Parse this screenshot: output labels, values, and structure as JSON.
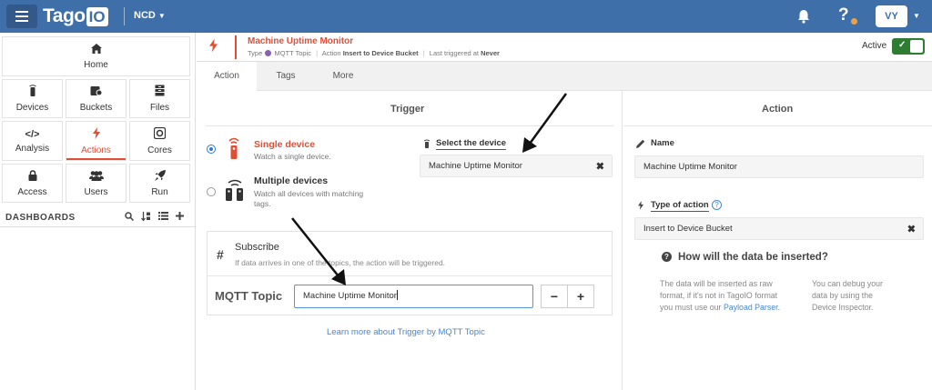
{
  "topbar": {
    "logo_tago": "Tago",
    "logo_io": "IO",
    "profile": "NCD",
    "avatar_initials": "VY",
    "help_glyph": "?"
  },
  "sidebar": {
    "tiles": [
      {
        "label": "Home",
        "icon": "home-icon"
      },
      {
        "label": "Devices",
        "icon": "device-icon"
      },
      {
        "label": "Buckets",
        "icon": "bucket-icon"
      },
      {
        "label": "Files",
        "icon": "file-cabinet-icon"
      },
      {
        "label": "Analysis",
        "icon": "code-icon"
      },
      {
        "label": "Actions",
        "icon": "bolt-icon"
      },
      {
        "label": "Cores",
        "icon": "core-icon"
      },
      {
        "label": "Access",
        "icon": "lock-icon"
      },
      {
        "label": "Users",
        "icon": "users-icon"
      },
      {
        "label": "Run",
        "icon": "rocket-icon"
      }
    ],
    "dashboards_heading": "DASHBOARDS"
  },
  "action_header": {
    "title": "Machine Uptime Monitor",
    "type_label": "Type",
    "type_value": "MQTT Topic",
    "action_label": "Action",
    "action_value": "Insert to Device Bucket",
    "last_triggered_label": "Last triggered at",
    "last_triggered_value": "Never",
    "active_label": "Active",
    "active_toggle": true,
    "accent_color": "#e04e36"
  },
  "tabs": [
    {
      "label": "Action",
      "active": true
    },
    {
      "label": "Tags",
      "active": false
    },
    {
      "label": "More",
      "active": false
    }
  ],
  "trigger": {
    "title": "Trigger",
    "options": [
      {
        "title": "Single device",
        "desc": "Watch a single device.",
        "checked": true
      },
      {
        "title": "Multiple devices",
        "desc_line1": "Watch all devices with matching",
        "desc_line2": "tags.",
        "checked": false
      }
    ],
    "select_device_label": "Select the device",
    "select_device_value": "Machine Uptime Monitor",
    "subscribe": {
      "title": "Subscribe",
      "desc": "If data arrives in one of the topics, the action will be triggered.",
      "mqtt_label": "MQTT Topic",
      "mqtt_value": "Machine Uptime Monitor",
      "minus": "−",
      "plus": "+"
    },
    "learn_more": "Learn more about Trigger by MQTT Topic"
  },
  "action": {
    "title": "Action",
    "name_label": "Name",
    "name_value": "Machine Uptime Monitor",
    "type_label": "Type of action",
    "type_value": "Insert to Device Bucket",
    "how_title": "How will the data be inserted?",
    "how_col1_line1": "The data will be inserted as raw",
    "how_col1_line2": "format, if it's not in TagoIO format",
    "how_col1_line3": "you must use our",
    "how_col1_link": "Payload Parser.",
    "how_col2_line1": "You can debug your",
    "how_col2_line2": "data by using the",
    "how_col2_line3": "Device Inspector."
  }
}
